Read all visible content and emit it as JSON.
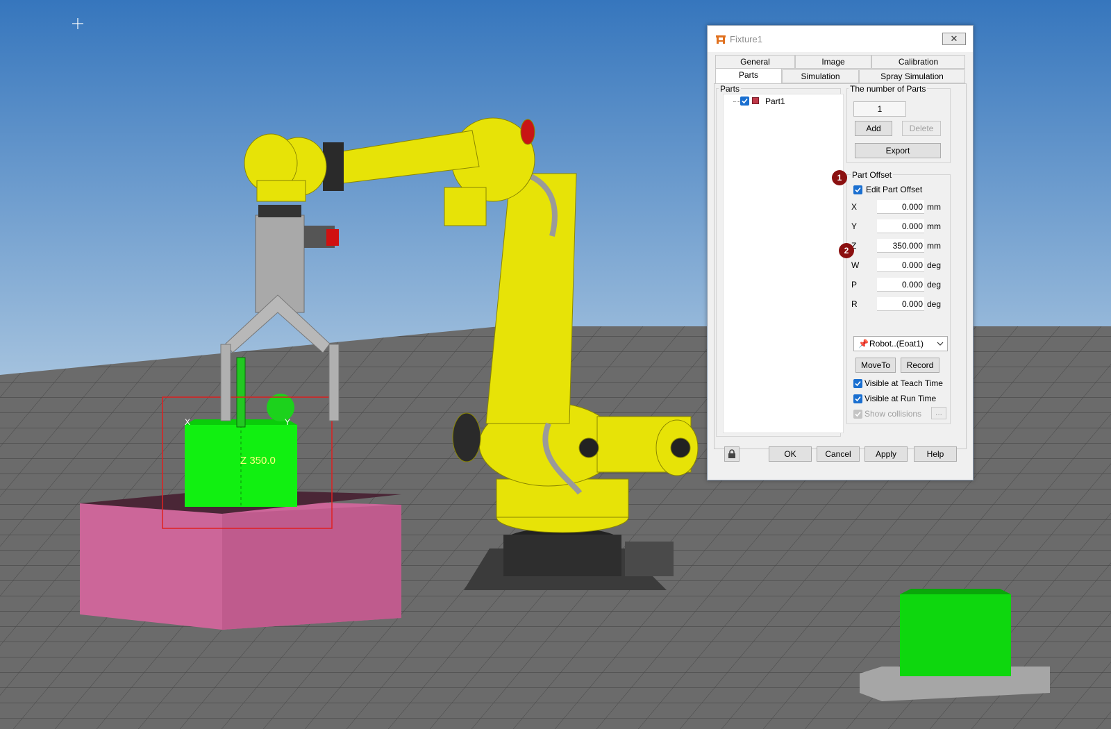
{
  "scene": {
    "overlay_label": "Z 350.0",
    "axis_x": "X",
    "axis_y": "Y",
    "colors": {
      "sky_top": "#3f7cc0",
      "floor": "#6b6b6b",
      "robot": "#e4e000",
      "part": "#00ff00",
      "table": "#d2679a"
    }
  },
  "dialog": {
    "title": "Fixture1",
    "close_label": "✕",
    "tabs_row1": [
      "General",
      "Image",
      "Calibration"
    ],
    "tabs_row2": [
      "Parts",
      "Simulation",
      "Spray Simulation"
    ],
    "active_tab": "Parts",
    "parts_group": {
      "legend": "Parts",
      "items": [
        {
          "label": "Part1",
          "checked": true
        }
      ]
    },
    "count_group": {
      "legend": "The number of Parts",
      "value": "1",
      "add_label": "Add",
      "delete_label": "Delete",
      "export_label": "Export"
    },
    "offset_group": {
      "legend": "Part Offset",
      "edit_label": "Edit Part Offset",
      "edit_checked": true,
      "fields": [
        {
          "axis": "X",
          "value": "0.000",
          "unit": "mm"
        },
        {
          "axis": "Y",
          "value": "0.000",
          "unit": "mm"
        },
        {
          "axis": "Z",
          "value": "350.000",
          "unit": "mm"
        },
        {
          "axis": "W",
          "value": "0.000",
          "unit": "deg"
        },
        {
          "axis": "P",
          "value": "0.000",
          "unit": "deg"
        },
        {
          "axis": "R",
          "value": "0.000",
          "unit": "deg"
        }
      ],
      "robot_select": "Robot..(Eoat1)",
      "moveto_label": "MoveTo",
      "record_label": "Record",
      "visible_teach_label": "Visible at Teach Time",
      "visible_run_label": "Visible at Run Time",
      "show_collisions_label": "Show collisions",
      "more_label": "..."
    },
    "footer": {
      "ok_label": "OK",
      "cancel_label": "Cancel",
      "apply_label": "Apply",
      "help_label": "Help"
    },
    "markers": [
      "1",
      "2"
    ]
  }
}
